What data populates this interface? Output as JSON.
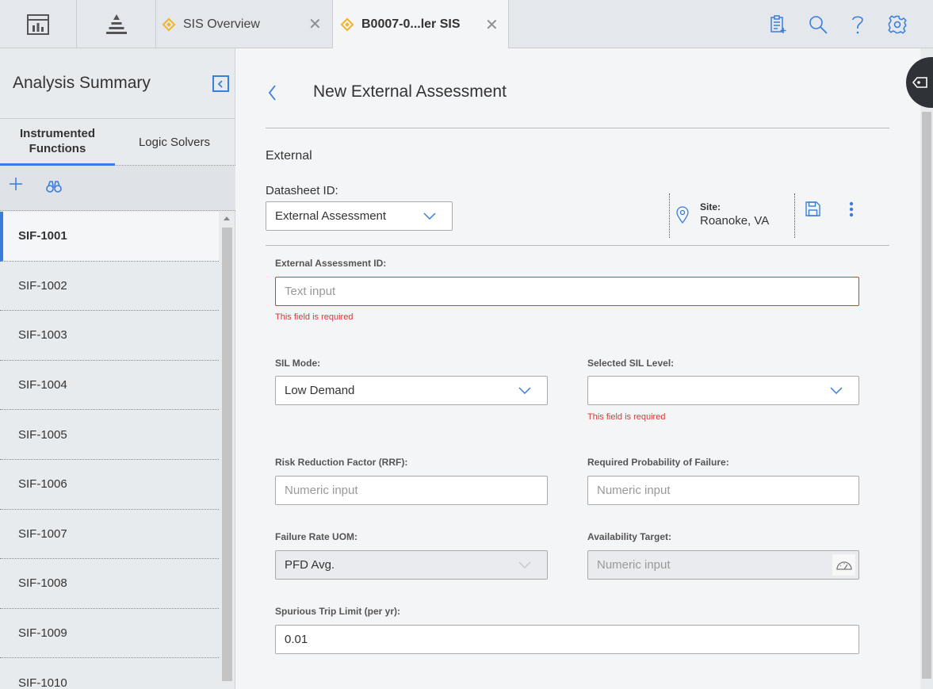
{
  "topbar": {
    "tabs": [
      {
        "label": "SIS Overview",
        "icon": "diamond-icon",
        "active": false
      },
      {
        "label": "B0007-0...ler SIS",
        "icon": "diamond-icon",
        "active": true
      }
    ],
    "icons": [
      "dashboard-icon",
      "pyramid-icon",
      "checklist-icon",
      "search-icon",
      "help-icon",
      "gear-icon"
    ]
  },
  "sidebar": {
    "title": "Analysis Summary",
    "tabs": [
      {
        "label": "Instrumented Functions",
        "active": true
      },
      {
        "label": "Logic Solvers",
        "active": false
      }
    ],
    "items": [
      "SIF-1001",
      "SIF-1002",
      "SIF-1003",
      "SIF-1004",
      "SIF-1005",
      "SIF-1006",
      "SIF-1007",
      "SIF-1008",
      "SIF-1009",
      "SIF-1010"
    ],
    "selected": "SIF-1001"
  },
  "main": {
    "title": "New External Assessment",
    "section": "External",
    "datasheet_label": "Datasheet ID:",
    "datasheet_value": "External Assessment",
    "site_label": "Site:",
    "site_value": "Roanoke, VA"
  },
  "form": {
    "external_id_label": "External Assessment ID:",
    "external_id_placeholder": "Text input",
    "external_id_error": "This field is required",
    "sil_mode_label": "SIL Mode:",
    "sil_mode_value": "Low Demand",
    "selected_sil_label": "Selected SIL Level:",
    "selected_sil_value": "",
    "selected_sil_error": "This field is required",
    "rrf_label": "Risk Reduction Factor (RRF):",
    "rrf_placeholder": "Numeric input",
    "req_pof_label": "Required Probability of Failure:",
    "req_pof_placeholder": "Numeric input",
    "failure_uom_label": "Failure Rate UOM:",
    "failure_uom_value": "PFD Avg.",
    "availability_label": "Availability Target:",
    "availability_placeholder": "Numeric input",
    "spurious_label": "Spurious Trip Limit (per yr):",
    "spurious_value": "0.01"
  }
}
